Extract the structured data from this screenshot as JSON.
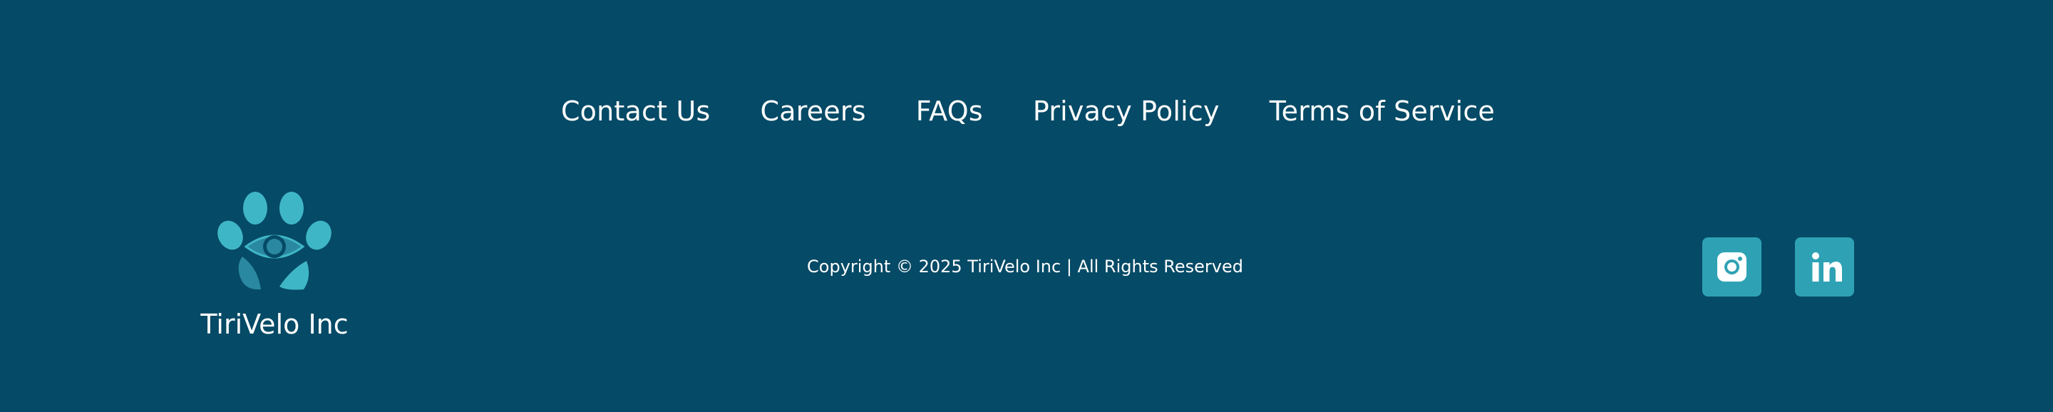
{
  "nav": {
    "links": [
      {
        "label": "Contact Us"
      },
      {
        "label": "Careers"
      },
      {
        "label": "FAQs"
      },
      {
        "label": "Privacy Policy"
      },
      {
        "label": "Terms of Service"
      }
    ]
  },
  "brand": {
    "name": "TiriVelo Inc",
    "logo_icon": "paw-eye-logo-icon"
  },
  "copyright": {
    "text": "Copyright © 2025 TiriVelo Inc | All Rights Reserved"
  },
  "social": [
    {
      "name": "instagram-icon"
    },
    {
      "name": "linkedin-icon"
    }
  ],
  "colors": {
    "background": "#054a66",
    "accent": "#2ea2b4",
    "logo_light": "#3fb6c6",
    "logo_dark": "#2a88a0",
    "text": "#ffffff"
  }
}
